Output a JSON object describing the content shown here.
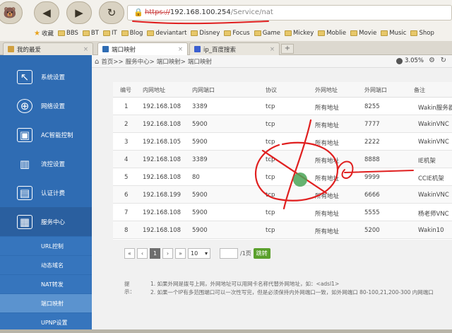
{
  "browser": {
    "url_protocol": "https://",
    "url_domain": "192.168.100.254",
    "url_path": "/Service/nat",
    "bookmarks": [
      "收藏",
      "BBS",
      "BT",
      "IT",
      "Blog",
      "deviantart",
      "Disney",
      "Focus",
      "Game",
      "Mickey",
      "Moblie",
      "Movie",
      "Music",
      "Shop"
    ],
    "tabs": [
      {
        "label": "我的最爱"
      },
      {
        "label": "端口映射"
      },
      {
        "label": "ip_百度搜索"
      }
    ],
    "new_tab": "+",
    "tab_close": "×"
  },
  "breadcrumb": {
    "items": [
      "首页>>",
      "服务中心>",
      "端口映射>",
      "端口映射"
    ],
    "zoom": "3.05%"
  },
  "sidebar": {
    "items": [
      {
        "label": "系统设置",
        "icon": "monitor-cursor-icon"
      },
      {
        "label": "网络设置",
        "icon": "globe-icon"
      },
      {
        "label": "AC智能控制",
        "icon": "ac-control-icon"
      },
      {
        "label": "流控设置",
        "icon": "bar-chart-icon"
      },
      {
        "label": "认证计费",
        "icon": "photo-auth-icon"
      },
      {
        "label": "服务中心",
        "icon": "service-center-icon"
      }
    ],
    "subitems": [
      "URL控制",
      "动态域名",
      "NAT转发",
      "端口映射",
      "UPNP设置"
    ]
  },
  "table": {
    "headers": [
      "编号",
      "内网地址",
      "内网端口",
      "协议",
      "外网地址",
      "外网端口",
      "备注"
    ],
    "rows": [
      [
        "1",
        "192.168.108",
        "3389",
        "tcp",
        "所有地址",
        "8255",
        "Wakin服务器"
      ],
      [
        "2",
        "192.168.108",
        "5900",
        "tcp",
        "所有地址",
        "7777",
        "WakinVNC"
      ],
      [
        "3",
        "192.168.105",
        "5900",
        "tcp",
        "所有地址",
        "2222",
        "WakinVNC"
      ],
      [
        "4",
        "192.168.108",
        "3389",
        "tcp",
        "所有地址",
        "8888",
        "IE机架"
      ],
      [
        "5",
        "192.168.108",
        "80",
        "tcp",
        "所有地址",
        "9999",
        "CCIE机架"
      ],
      [
        "6",
        "192.168.199",
        "5900",
        "tcp",
        "所有地址",
        "6666",
        "WakinVNC"
      ],
      [
        "7",
        "192.168.108",
        "5900",
        "tcp",
        "所有地址",
        "5555",
        "杨老师VNC"
      ],
      [
        "8",
        "192.168.108",
        "5900",
        "tcp",
        "所有地址",
        "5200",
        "Wakin10"
      ]
    ]
  },
  "pager": {
    "first": "«",
    "prev": "‹",
    "current": "1",
    "next": "›",
    "last": "»",
    "page_size": "10",
    "total": "/1页",
    "go": "跳转"
  },
  "tips": {
    "label": "提示：",
    "line1": "1. 如果外网是拨号上网，外网地址可以用网卡名称代替外网地址，如：<adsl1>",
    "line2": "2. 如果一个IP有多范围端口可以一次性写完，但是必须保持内外网端口一致，如外网端口 80-100,21,200-300 内网端口"
  },
  "colors": {
    "sidebar": "#2f6cb3",
    "go_button": "#5aa02c",
    "annotation": "#e02020"
  }
}
